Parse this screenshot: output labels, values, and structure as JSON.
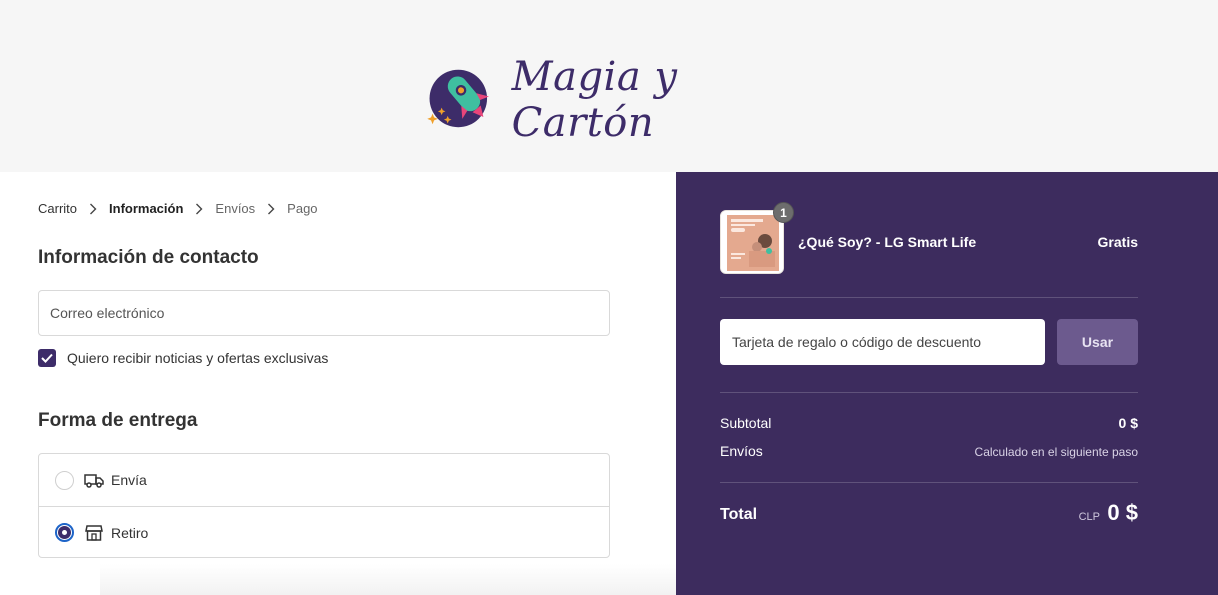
{
  "brand": {
    "name": "Magia y Cartón",
    "colors": {
      "primary": "#3d2c69",
      "summary_bg": "#3d2c5e",
      "rocket_teal": "#3fbfa0",
      "rocket_pink": "#e8457a",
      "star_orange": "#f0a02a"
    }
  },
  "breadcrumb": [
    {
      "label": "Carrito",
      "state": "link"
    },
    {
      "label": "Información",
      "state": "current"
    },
    {
      "label": "Envíos",
      "state": "upcoming"
    },
    {
      "label": "Pago",
      "state": "upcoming"
    }
  ],
  "contact": {
    "title": "Información de contacto",
    "email_placeholder": "Correo electrónico",
    "email_value": "",
    "newsletter_label": "Quiero recibir noticias y ofertas exclusivas",
    "newsletter_checked": true
  },
  "delivery": {
    "title": "Forma de entrega",
    "options": [
      {
        "label": "Envía",
        "icon": "truck-icon",
        "selected": false
      },
      {
        "label": "Retiro",
        "icon": "store-icon",
        "selected": true
      }
    ]
  },
  "summary": {
    "product": {
      "name": "¿Qué Soy? - LG Smart Life",
      "price": "Gratis",
      "quantity": "1"
    },
    "discount": {
      "placeholder": "Tarjeta de regalo o código de descuento",
      "button_label": "Usar"
    },
    "subtotal_label": "Subtotal",
    "subtotal_value": "0 $",
    "shipping_label": "Envíos",
    "shipping_value": "Calculado en el siguiente paso",
    "total_label": "Total",
    "total_currency": "CLP",
    "total_value": "0 $"
  }
}
